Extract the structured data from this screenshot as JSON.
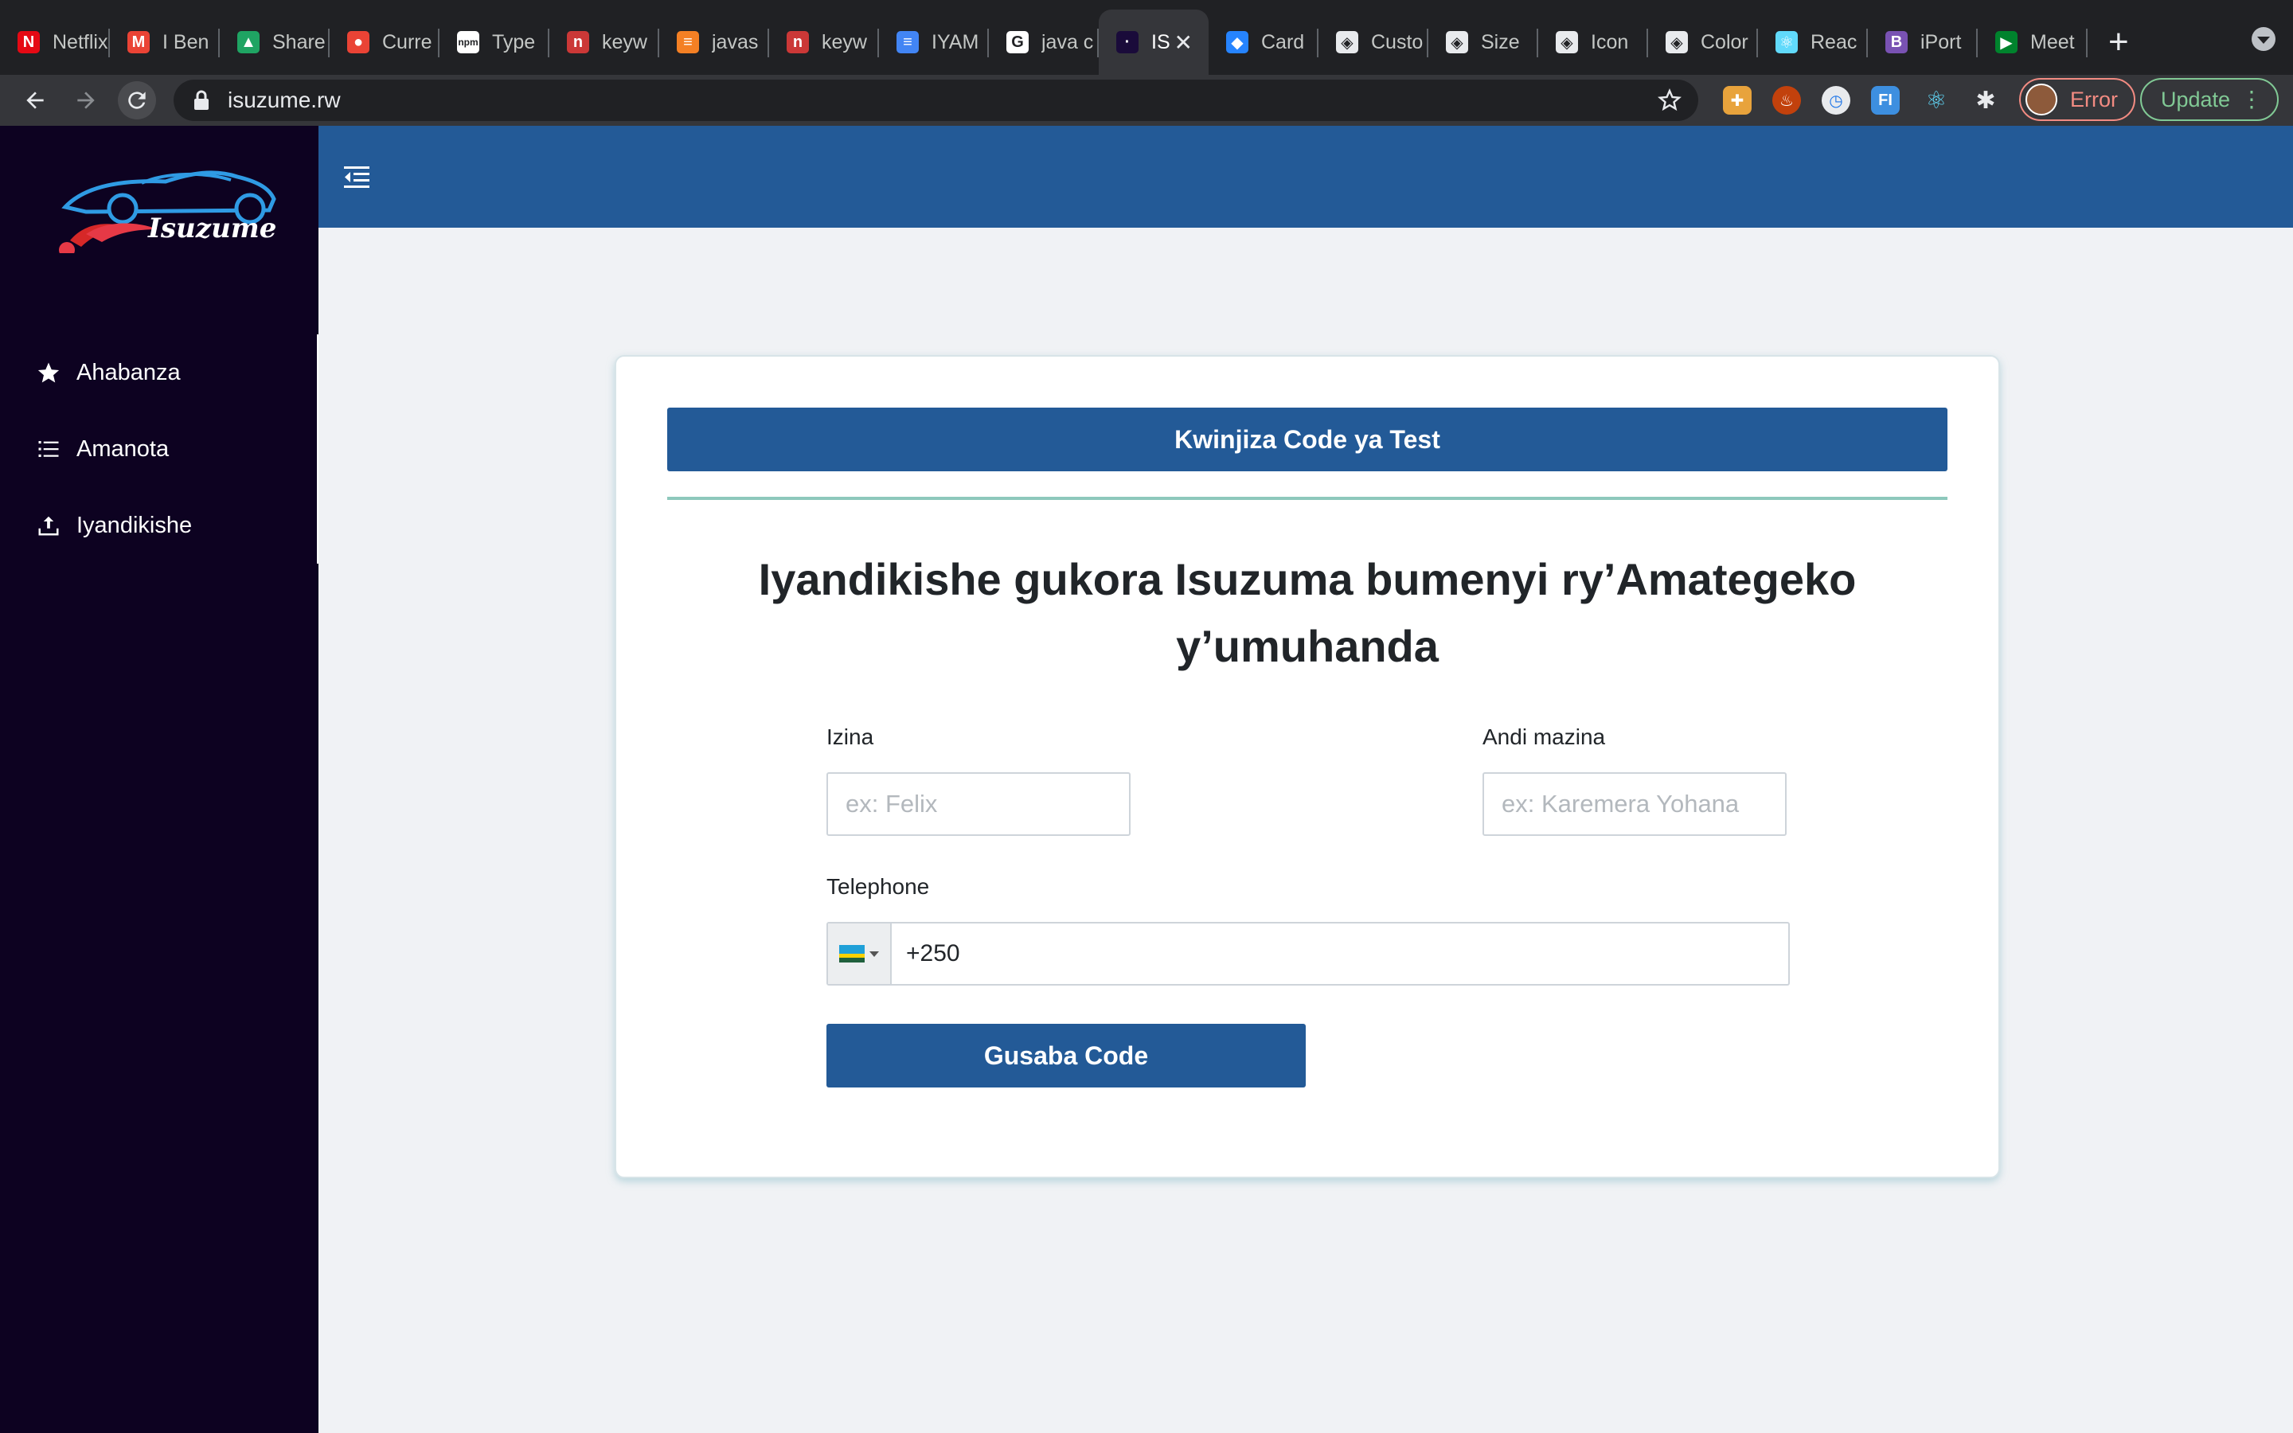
{
  "browser": {
    "tabs": [
      {
        "label": "Netflix",
        "icon": "netflix-icon",
        "color": "#e50914",
        "glyph": "N"
      },
      {
        "label": "I Ben",
        "icon": "gmail-icon",
        "color": "#ea4335",
        "glyph": "M"
      },
      {
        "label": "Share",
        "icon": "drive-icon",
        "color": "#1fa463",
        "glyph": "▲"
      },
      {
        "label": "Curre",
        "icon": "maps-icon",
        "color": "#ea4335",
        "glyph": "●"
      },
      {
        "label": "Type",
        "icon": "npm-icon",
        "color": "#ffffff",
        "glyph": "npm"
      },
      {
        "label": "keyw",
        "icon": "npm-red-icon",
        "color": "#cb3837",
        "glyph": "n"
      },
      {
        "label": "javas",
        "icon": "stackoverflow-icon",
        "color": "#f48024",
        "glyph": "≡"
      },
      {
        "label": "keyw",
        "icon": "npm-red-icon",
        "color": "#cb3837",
        "glyph": "n"
      },
      {
        "label": "IYAM",
        "icon": "docs-icon",
        "color": "#4285f4",
        "glyph": "≡"
      },
      {
        "label": "java c",
        "icon": "google-icon",
        "color": "#ffffff",
        "glyph": "G"
      },
      {
        "label": "IS",
        "icon": "isuzume-icon",
        "color": "#1a0b3a",
        "glyph": "·",
        "active": true
      },
      {
        "label": "Card",
        "icon": "jira-icon",
        "color": "#2684ff",
        "glyph": "◆"
      },
      {
        "label": "Custo",
        "icon": "codesandbox-icon",
        "color": "#e8eaed",
        "glyph": "◈"
      },
      {
        "label": "Size",
        "icon": "codesandbox-icon",
        "color": "#e8eaed",
        "glyph": "◈"
      },
      {
        "label": "Icon",
        "icon": "codesandbox-icon",
        "color": "#e8eaed",
        "glyph": "◈"
      },
      {
        "label": "Color",
        "icon": "codesandbox-icon",
        "color": "#e8eaed",
        "glyph": "◈"
      },
      {
        "label": "Reac",
        "icon": "react-icon",
        "color": "#61dafb",
        "glyph": "⚛"
      },
      {
        "label": "iPort",
        "icon": "bootstrap-icon",
        "color": "#7952b3",
        "glyph": "B"
      },
      {
        "label": "Meet",
        "icon": "meet-icon",
        "color": "#00832d",
        "glyph": "▶"
      }
    ],
    "url": "isuzume.rw",
    "profile_status": "Error",
    "update_label": "Update"
  },
  "sidebar": {
    "logo_text": "Isuzume",
    "items": [
      {
        "label": "Ahabanza",
        "icon": "star-icon"
      },
      {
        "label": "Amanota",
        "icon": "list-icon"
      },
      {
        "label": "Iyandikishe",
        "icon": "upload-icon"
      }
    ]
  },
  "form": {
    "header": "Kwinjiza Code ya Test",
    "title": "Iyandikishe gukora Isuzuma bumenyi ry’Amategeko y’umuhanda",
    "first_name": {
      "label": "Izina",
      "placeholder": "ex: Felix"
    },
    "last_name": {
      "label": "Andi mazina",
      "placeholder": "ex: Karemera Yohana"
    },
    "phone": {
      "label": "Telephone",
      "value": "+250",
      "country": "Rwanda"
    },
    "submit_label": "Gusaba Code"
  },
  "colors": {
    "primary": "#235a97",
    "sidebar_bg": "#0d0221",
    "divider": "#8ec8bc",
    "page_bg": "#f0f2f5"
  }
}
